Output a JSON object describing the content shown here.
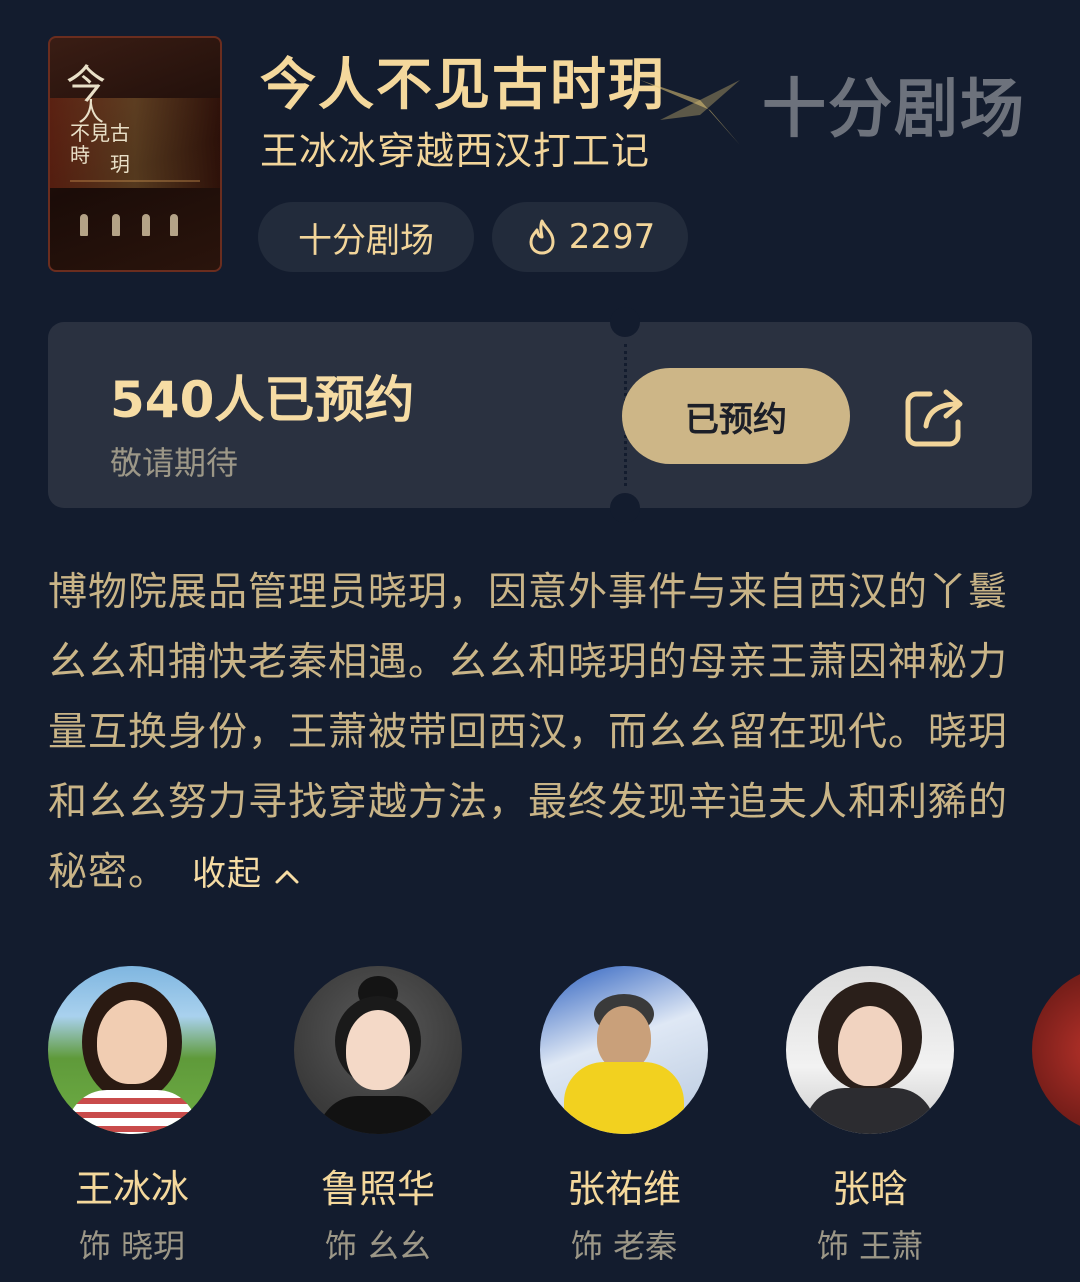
{
  "show": {
    "title": "今人不见古时玥",
    "subtitle": "王冰冰穿越西汉打工记",
    "studio_chip": "十分剧场",
    "heat_count": "2297",
    "poster_text": "今人不见古时玥"
  },
  "watermark": {
    "text": "十分剧场"
  },
  "reservation": {
    "count_text": "540人已预约",
    "hint": "敬请期待",
    "button_label": "已预约",
    "share_icon": "share-icon"
  },
  "description": {
    "text": "博物院展品管理员晓玥，因意外事件与来自西汉的丫鬟幺幺和捕快老秦相遇。幺幺和晓玥的母亲王萧因神秘力量互换身份，王萧被带回西汉，而幺幺留在现代。晓玥和幺幺努力寻找穿越方法，最终发现辛追夫人和利豨的秘密。",
    "collapse_label": "收起"
  },
  "cast": [
    {
      "name": "王冰冰",
      "role": "饰 晓玥"
    },
    {
      "name": "鲁照华",
      "role": "饰 幺幺"
    },
    {
      "name": "张祐维",
      "role": "饰 老秦"
    },
    {
      "name": "张晗",
      "role": "饰 王萧"
    }
  ],
  "colors": {
    "background": "#131c2e",
    "accent_gold": "#f4d89c",
    "button_gold": "#cdb687",
    "card": "#2a3140",
    "chip": "#222b3b"
  }
}
